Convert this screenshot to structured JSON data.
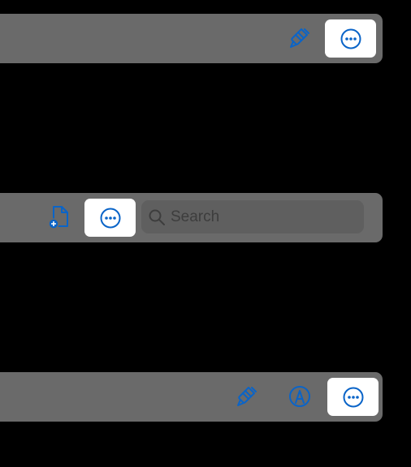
{
  "colors": {
    "background": "#000000",
    "toolbar": "#6a6a6a",
    "search_field": "#5f5f5f",
    "accent_blue": "#0a64c8",
    "highlight": "#ffffff"
  },
  "toolbars": [
    {
      "id": "toolbar-top",
      "items": [
        {
          "icon": "paintbrush-icon"
        },
        {
          "icon": "more-ellipsis-icon",
          "highlighted": true
        }
      ]
    },
    {
      "id": "toolbar-middle",
      "items": [
        {
          "icon": "new-document-icon"
        },
        {
          "icon": "more-ellipsis-icon",
          "highlighted": true
        }
      ],
      "search": {
        "icon": "search-icon",
        "placeholder": "Search"
      }
    },
    {
      "id": "toolbar-bottom",
      "items": [
        {
          "icon": "paintbrush-icon"
        },
        {
          "icon": "markup-pen-icon"
        },
        {
          "icon": "more-ellipsis-icon",
          "highlighted": true
        }
      ]
    }
  ]
}
